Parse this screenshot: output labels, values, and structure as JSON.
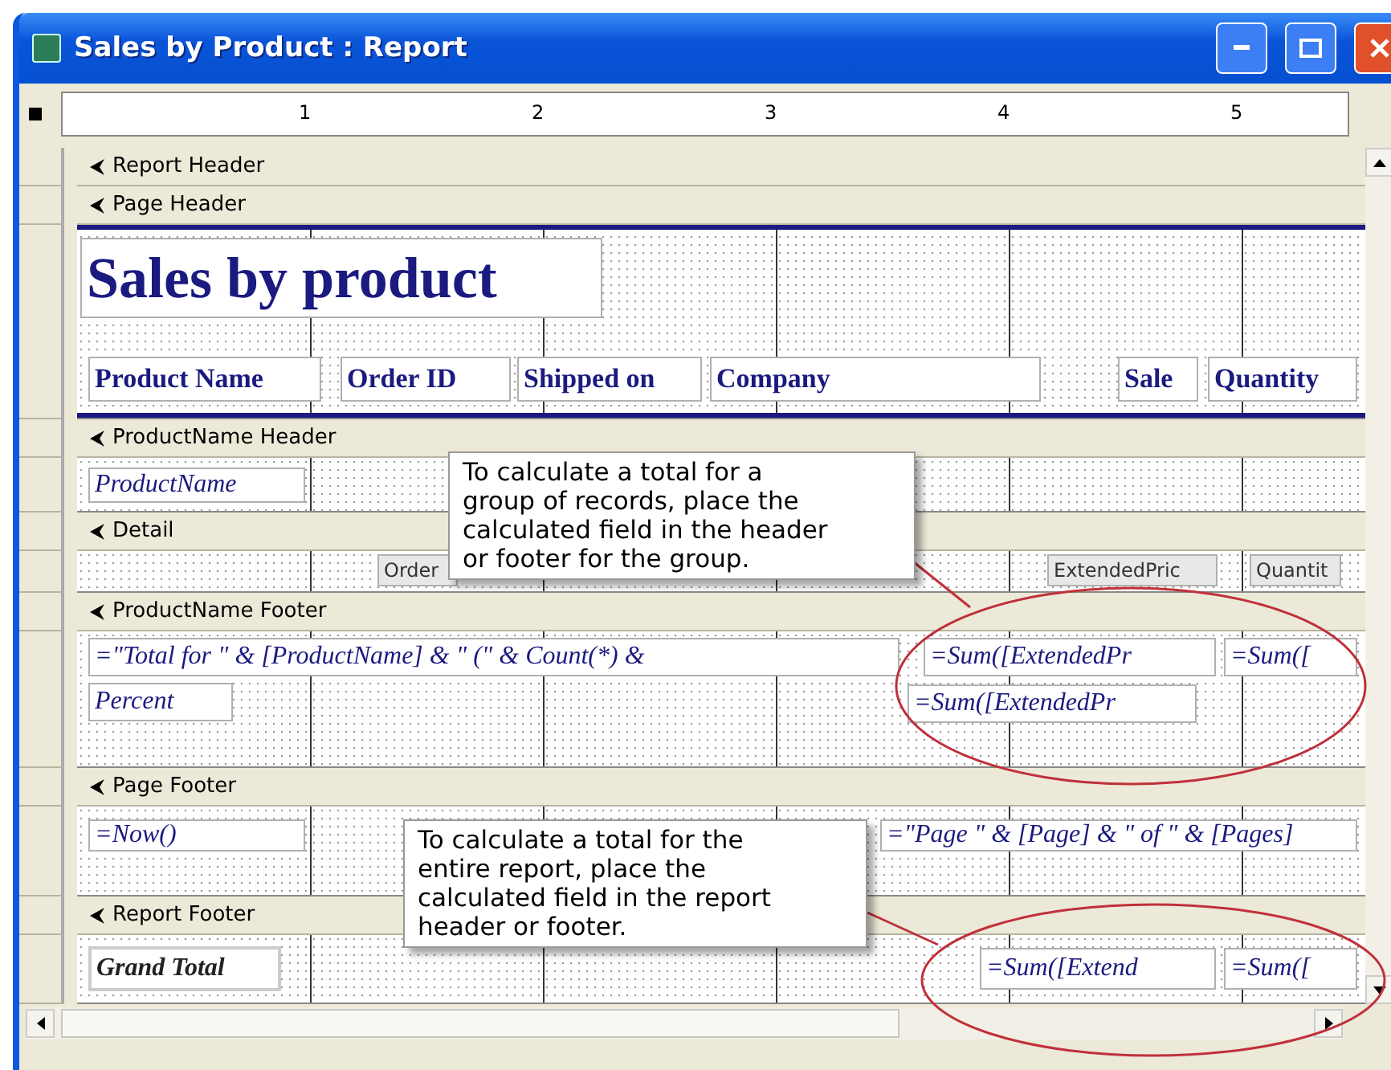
{
  "window": {
    "title": "Sales by Product : Report"
  },
  "ruler": {
    "marks": [
      "1",
      "2",
      "3",
      "4",
      "5"
    ]
  },
  "sections": [
    {
      "title": "Report Header"
    },
    {
      "title": "Page Header",
      "controls": [
        {
          "kind": "title",
          "text": "Sales by product"
        },
        {
          "kind": "label",
          "text": "Product Name"
        },
        {
          "kind": "label",
          "text": "Order ID"
        },
        {
          "kind": "label",
          "text": "Shipped on"
        },
        {
          "kind": "label",
          "text": "Company"
        },
        {
          "kind": "label",
          "text": "Sale"
        },
        {
          "kind": "label",
          "text": "Quantity"
        }
      ]
    },
    {
      "title": "ProductName Header",
      "controls": [
        {
          "kind": "field",
          "text": "ProductName"
        }
      ]
    },
    {
      "title": "Detail",
      "controls": [
        {
          "kind": "plain",
          "text": "Order"
        },
        {
          "kind": "plain",
          "text": "ExtendedPric"
        },
        {
          "kind": "plain",
          "text": "Quantit"
        }
      ]
    },
    {
      "title": "ProductName Footer",
      "controls": [
        {
          "kind": "field",
          "text": "=\"Total for \" & [ProductName] & \" (\" & Count(*) &"
        },
        {
          "kind": "field",
          "text": "=Sum([ExtendedPr"
        },
        {
          "kind": "field",
          "text": "=Sum(["
        },
        {
          "kind": "field",
          "text": "Percent"
        },
        {
          "kind": "field",
          "text": "=Sum([ExtendedPr"
        }
      ]
    },
    {
      "title": "Page Footer",
      "controls": [
        {
          "kind": "field",
          "text": "=Now()"
        },
        {
          "kind": "field",
          "text": "=\"Page \" & [Page] & \" of \" & [Pages]"
        }
      ]
    },
    {
      "title": "Report Footer",
      "controls": [
        {
          "kind": "total",
          "text": "Grand Total"
        },
        {
          "kind": "field",
          "text": "=Sum([Extend"
        },
        {
          "kind": "field",
          "text": "=Sum(["
        }
      ]
    }
  ],
  "callouts": [
    {
      "text": "To calculate a total for a\ngroup of records, place the\ncalculated field in the header\nor footer for the group."
    },
    {
      "text": "To calculate a total for the\nentire report, place the\ncalculated field in the report\nheader or footer."
    }
  ]
}
